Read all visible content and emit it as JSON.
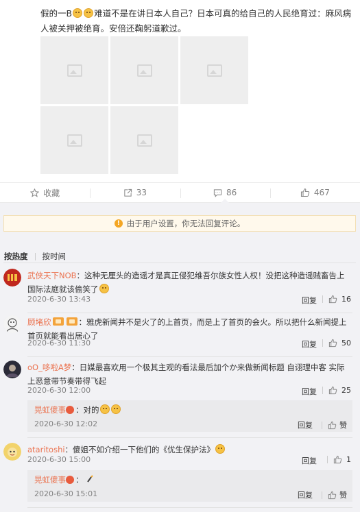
{
  "post": {
    "text_part1": "假的一B",
    "text_part2": "难道不是在讲日本人自己？日本可真的给自己的人民绝育过：麻风病人被关押被绝育。安倍还鞠躬道歉过。",
    "emoji_icon": "face-emoji-icon"
  },
  "actions": {
    "favorite": "收藏",
    "repost_count": "33",
    "comment_count": "86",
    "like_count": "467"
  },
  "notice": {
    "text": "由于用户设置，你无法回复评论。"
  },
  "sort": {
    "hot": "按热度",
    "time": "按时间"
  },
  "comments": [
    {
      "user": "武侠天下NOB",
      "text": "：这种无厘头的造谣才是真正侵犯维吾尔族女性人权！没把这种造谣贼畜告上国际法庭就该偷笑了",
      "date": "2020-6-30 13:43",
      "reply": "回复",
      "likes": "16"
    },
    {
      "user": "顾堵欣",
      "text": "：雅虎新闻并不是火了的上首页，而是上了首页的会火。所以把什么新闻提上首页就能看出居心了",
      "date": "2020-6-30 11:30",
      "reply": "回复",
      "likes": "50"
    },
    {
      "user": "oO_哆啦A梦",
      "text": "：日媒最喜欢用一个极其主观的看法最后加个か来做新闻标题 自诩理中客 实际上恶意带节奏带得飞起",
      "date": "2020-6-30 12:00",
      "reply": "回复",
      "likes": "25"
    },
    {
      "user": "ataritoshi",
      "text": "：傻姐不如介绍一下他们的《优生保护法》",
      "date": "2020-6-30 15:00",
      "reply": "回复",
      "likes": "1"
    }
  ],
  "sub_replies": [
    {
      "user": "晃虹傻事",
      "text": "：对的",
      "date": "2020-6-30 12:02",
      "reply": "回复",
      "likes": "赞"
    },
    {
      "user": "晃虹傻事",
      "text": "：",
      "date": "2020-6-30 15:01",
      "reply": "回复",
      "likes": "赞"
    }
  ],
  "colors": {
    "username": "#eb7350",
    "background": "#f2f2f5",
    "notice_bg": "#fff9ec"
  }
}
